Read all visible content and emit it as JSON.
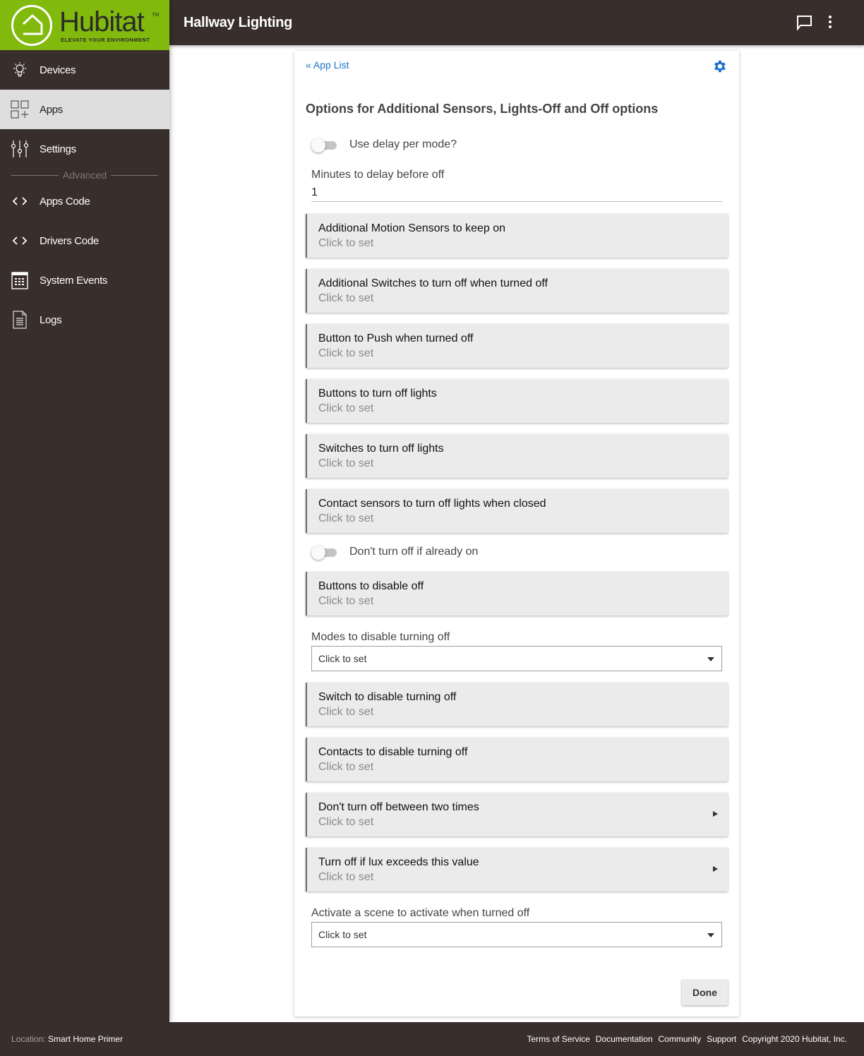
{
  "brand": {
    "name": "Hubitat",
    "trademark": "TM",
    "tagline": "ELEVATE YOUR ENVIRONMENT",
    "color": "#81b90d"
  },
  "sidebar": {
    "items": [
      {
        "label": "Devices",
        "icon": "lightbulb-icon",
        "active": false
      },
      {
        "label": "Apps",
        "icon": "apps-grid-icon",
        "active": true
      },
      {
        "label": "Settings",
        "icon": "sliders-icon",
        "active": false
      }
    ],
    "divider_label": "Advanced",
    "advanced_items": [
      {
        "label": "Apps Code",
        "icon": "code-icon"
      },
      {
        "label": "Drivers Code",
        "icon": "code-icon"
      },
      {
        "label": "System Events",
        "icon": "calendar-icon"
      },
      {
        "label": "Logs",
        "icon": "document-icon"
      }
    ]
  },
  "header": {
    "title": "Hallway Lighting",
    "actions": [
      {
        "icon": "chat-icon"
      },
      {
        "icon": "more-vertical-icon"
      }
    ]
  },
  "main": {
    "back_link": "« App List",
    "settings_icon": "gear-icon",
    "heading": "Options for Additional Sensors, Lights-Off and Off options",
    "use_delay_toggle": {
      "label": "Use delay per mode?",
      "on": false
    },
    "minutes_field": {
      "label": "Minutes to delay before off",
      "value": "1"
    },
    "group1": [
      {
        "title": "Additional Motion Sensors to keep on",
        "sub": "Click to set"
      },
      {
        "title": "Additional Switches to turn off when turned off",
        "sub": "Click to set"
      },
      {
        "title": "Button to Push when turned off",
        "sub": "Click to set"
      },
      {
        "title": "Buttons to turn off lights",
        "sub": "Click to set"
      },
      {
        "title": "Switches to turn off lights",
        "sub": "Click to set"
      },
      {
        "title": "Contact sensors to turn off lights when closed",
        "sub": "Click to set"
      }
    ],
    "dont_turn_off_toggle": {
      "label": "Don't turn off if already on",
      "on": false
    },
    "buttons_disable": {
      "title": "Buttons to disable off",
      "sub": "Click to set"
    },
    "modes_select": {
      "label": "Modes to disable turning off",
      "value": "Click to set"
    },
    "group2": [
      {
        "title": "Switch to disable turning off",
        "sub": "Click to set"
      },
      {
        "title": "Contacts to disable turning off",
        "sub": "Click to set"
      }
    ],
    "group3": [
      {
        "title": "Don't turn off between two times",
        "sub": "Click to set"
      },
      {
        "title": "Turn off if lux exceeds this value",
        "sub": "Click to set"
      }
    ],
    "scene_select": {
      "label": "Activate a scene to activate when turned off",
      "value": "Click to set"
    },
    "done_label": "Done"
  },
  "footer": {
    "location_label": "Location:",
    "location_value": "Smart Home Primer",
    "links": [
      "Terms of Service",
      "Documentation",
      "Community",
      "Support"
    ],
    "copyright": "Copyright 2020 Hubitat, Inc."
  }
}
